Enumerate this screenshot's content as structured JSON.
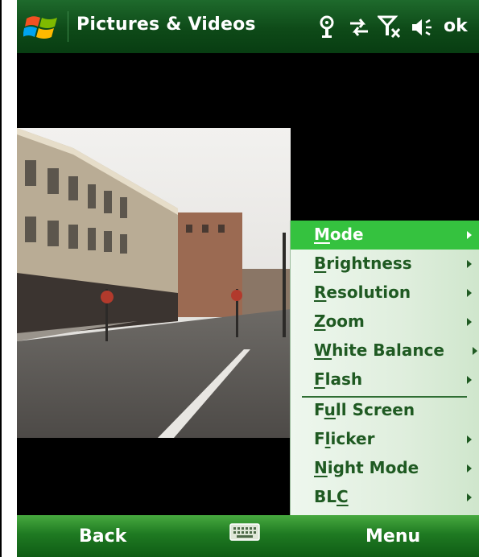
{
  "titlebar": {
    "title": "Pictures & Videos",
    "ok_label": "ok",
    "status_icons": [
      "location-icon",
      "data-sync-icon",
      "no-signal-icon",
      "speaker-icon"
    ]
  },
  "menu": {
    "items": [
      {
        "pre": "",
        "key": "M",
        "post": "ode",
        "submenu": true,
        "selected": true
      },
      {
        "pre": "",
        "key": "B",
        "post": "rightness",
        "submenu": true,
        "selected": false
      },
      {
        "pre": "",
        "key": "R",
        "post": "esolution",
        "submenu": true,
        "selected": false
      },
      {
        "pre": "",
        "key": "Z",
        "post": "oom",
        "submenu": true,
        "selected": false
      },
      {
        "pre": "",
        "key": "W",
        "post": "hite Balance",
        "submenu": true,
        "selected": false
      },
      {
        "pre": "",
        "key": "F",
        "post": "lash",
        "submenu": true,
        "selected": false
      },
      {
        "pre": "F",
        "key": "u",
        "post": "ll Screen",
        "submenu": false,
        "selected": false
      },
      {
        "pre": "F",
        "key": "l",
        "post": "icker",
        "submenu": true,
        "selected": false
      },
      {
        "pre": "",
        "key": "N",
        "post": "ight Mode",
        "submenu": true,
        "selected": false
      },
      {
        "pre": "BL",
        "key": "C",
        "post": "",
        "submenu": true,
        "selected": false
      }
    ]
  },
  "softkeys": {
    "left": "Back",
    "right": "Menu",
    "center_icon": "keyboard-icon"
  },
  "colors": {
    "titlebar": "#0e4a18",
    "softbar": "#1f7a22",
    "menu_selected": "#35c23f",
    "menu_text": "#1f5a22"
  }
}
